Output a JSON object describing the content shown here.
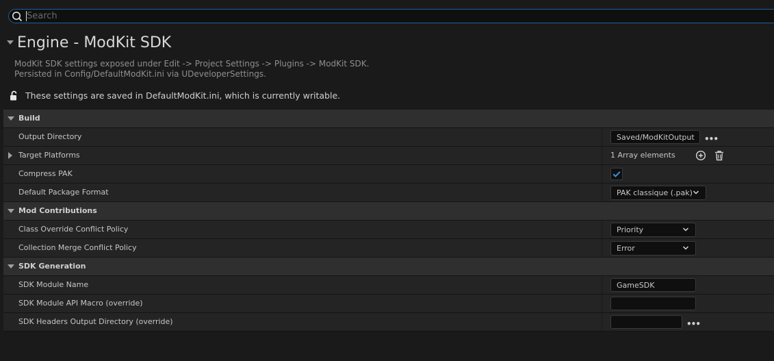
{
  "search": {
    "placeholder": "Search"
  },
  "header": {
    "title": "Engine - ModKit SDK",
    "description_line1": "ModKit SDK settings exposed under Edit -> Project Settings -> Plugins -> ModKit SDK.",
    "description_line2": "Persisted in Config/DefaultModKit.ini via UDeveloperSettings.",
    "notice": "These settings are saved in DefaultModKit.ini, which is currently writable."
  },
  "sections": {
    "build": {
      "label": "Build",
      "output_directory": {
        "label": "Output Directory",
        "value": "Saved/ModKitOutput"
      },
      "target_platforms": {
        "label": "Target Platforms",
        "value": "1 Array elements"
      },
      "compress_pak": {
        "label": "Compress PAK",
        "checked": true
      },
      "default_package_format": {
        "label": "Default Package Format",
        "value": "PAK classique (.pak)"
      }
    },
    "mod_contributions": {
      "label": "Mod Contributions",
      "class_override": {
        "label": "Class Override Conflict Policy",
        "value": "Priority"
      },
      "collection_merge": {
        "label": "Collection Merge Conflict Policy",
        "value": "Error"
      }
    },
    "sdk_generation": {
      "label": "SDK Generation",
      "module_name": {
        "label": "SDK Module Name",
        "value": "GameSDK"
      },
      "api_macro": {
        "label": "SDK Module API Macro (override)",
        "value": ""
      },
      "headers_dir": {
        "label": "SDK Headers Output Directory (override)",
        "value": ""
      }
    }
  },
  "icons": {
    "search": "search-icon",
    "lock": "unlock-icon",
    "add": "add-element-icon",
    "delete": "trash-icon",
    "browse": "ellipsis-icon",
    "dropdown": "chevron-down-icon"
  },
  "colors": {
    "accent": "#1f5f9f",
    "checkmark": "#3d8fe0"
  }
}
